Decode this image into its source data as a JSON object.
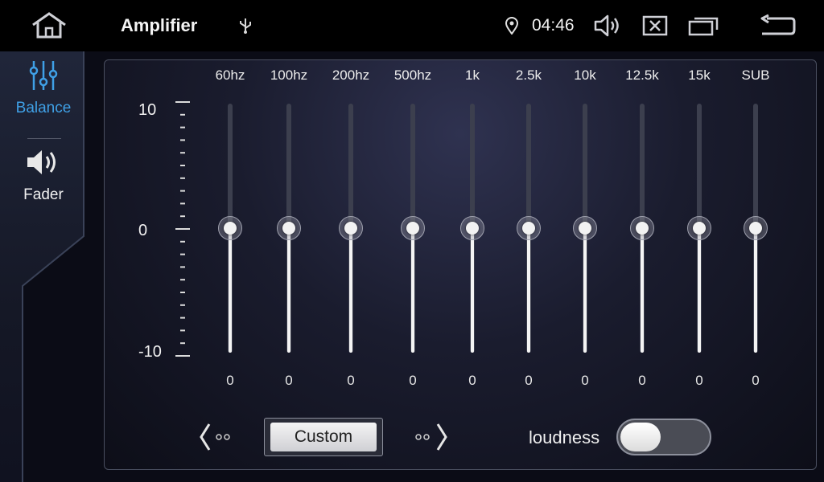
{
  "header": {
    "title": "Amplifier",
    "time": "04:46",
    "icons": [
      "home-icon",
      "usb-icon",
      "location-icon",
      "volume-icon",
      "close-window-icon",
      "recent-apps-icon",
      "back-icon"
    ]
  },
  "sidebar": {
    "items": [
      {
        "label": "Balance",
        "icon": "equalizer-sliders-icon",
        "active": true
      },
      {
        "label": "Fader",
        "icon": "speaker-icon",
        "active": false
      }
    ]
  },
  "equalizer": {
    "scale": {
      "max": "10",
      "mid": "0",
      "min": "-10"
    },
    "range": [
      -10,
      10
    ],
    "bands": [
      {
        "name": "60hz",
        "value": 0,
        "display": "0"
      },
      {
        "name": "100hz",
        "value": 0,
        "display": "0"
      },
      {
        "name": "200hz",
        "value": 0,
        "display": "0"
      },
      {
        "name": "500hz",
        "value": 0,
        "display": "0"
      },
      {
        "name": "1k",
        "value": 0,
        "display": "0"
      },
      {
        "name": "2.5k",
        "value": 0,
        "display": "0"
      },
      {
        "name": "10k",
        "value": 0,
        "display": "0"
      },
      {
        "name": "12.5k",
        "value": 0,
        "display": "0"
      },
      {
        "name": "15k",
        "value": 0,
        "display": "0"
      },
      {
        "name": "SUB",
        "value": 0,
        "display": "0"
      }
    ]
  },
  "controls": {
    "preset_label": "Custom",
    "loudness_label": "loudness",
    "loudness_on": false
  },
  "colors": {
    "accent": "#3fa0e6",
    "background": "#0b0c16"
  }
}
